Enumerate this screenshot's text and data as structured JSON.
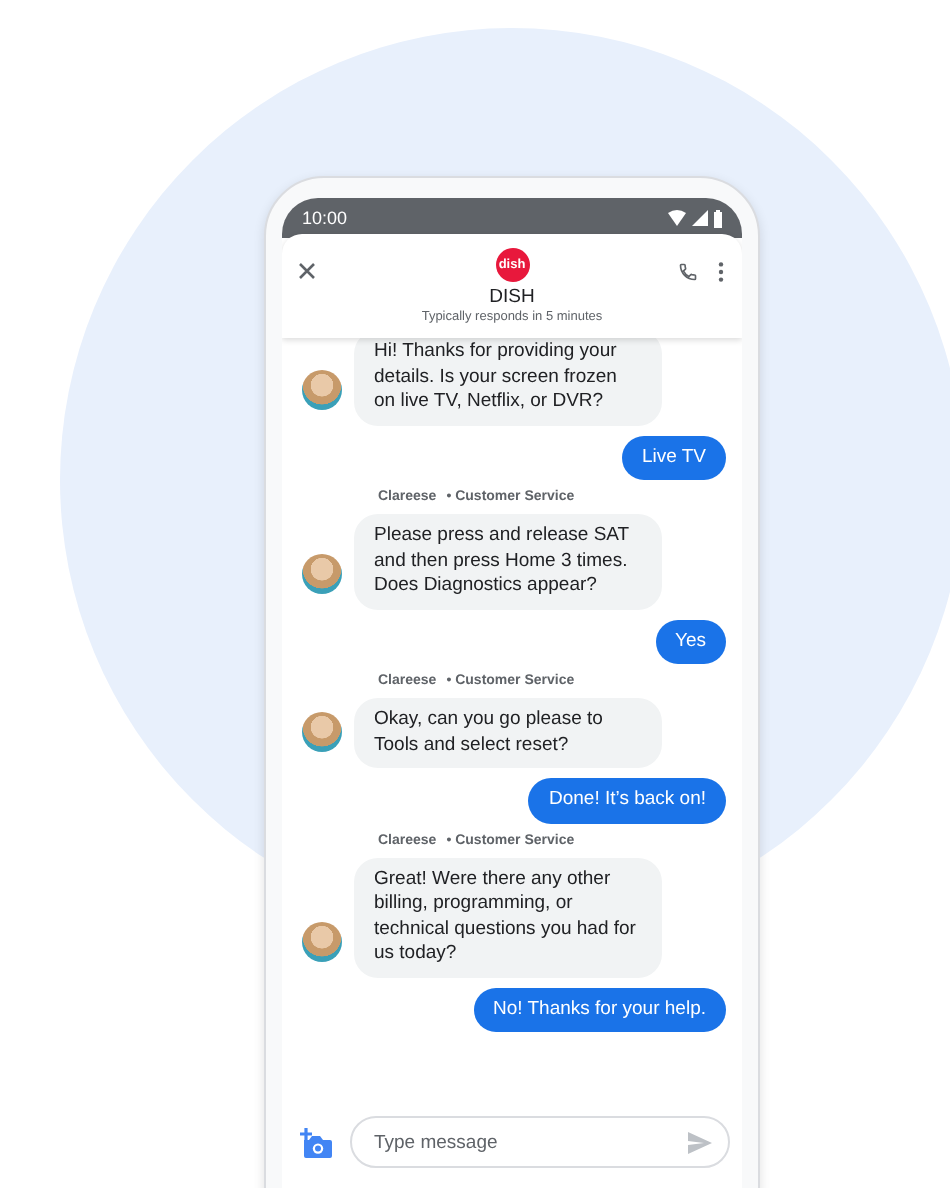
{
  "status_bar": {
    "time": "10:00"
  },
  "header": {
    "logo": "dish",
    "title": "DISH",
    "subtitle": "Typically responds in 5 minutes"
  },
  "messages": [
    {
      "kind": "incoming",
      "text": "Hi! Thanks for providing your details. Is your screen frozen on live TV, Netflix, or DVR?"
    },
    {
      "kind": "outgoing",
      "text": "Live TV"
    },
    {
      "kind": "incoming",
      "sender": "Clareese",
      "role": "• Customer Service",
      "text": "Please press and release SAT and then press Home 3 times. Does Diagnostics appear?"
    },
    {
      "kind": "outgoing",
      "text": "Yes"
    },
    {
      "kind": "incoming",
      "sender": "Clareese",
      "role": "• Customer Service",
      "text": "Okay, can you go please to Tools and select reset?"
    },
    {
      "kind": "outgoing",
      "text": "Done! It’s back on!"
    },
    {
      "kind": "incoming",
      "sender": "Clareese",
      "role": "• Customer Service",
      "text": "Great! Were there any other billing, programming, or technical questions you had for us today?"
    },
    {
      "kind": "outgoing",
      "text": "No! Thanks for your help."
    }
  ],
  "composer": {
    "placeholder": "Type message"
  }
}
